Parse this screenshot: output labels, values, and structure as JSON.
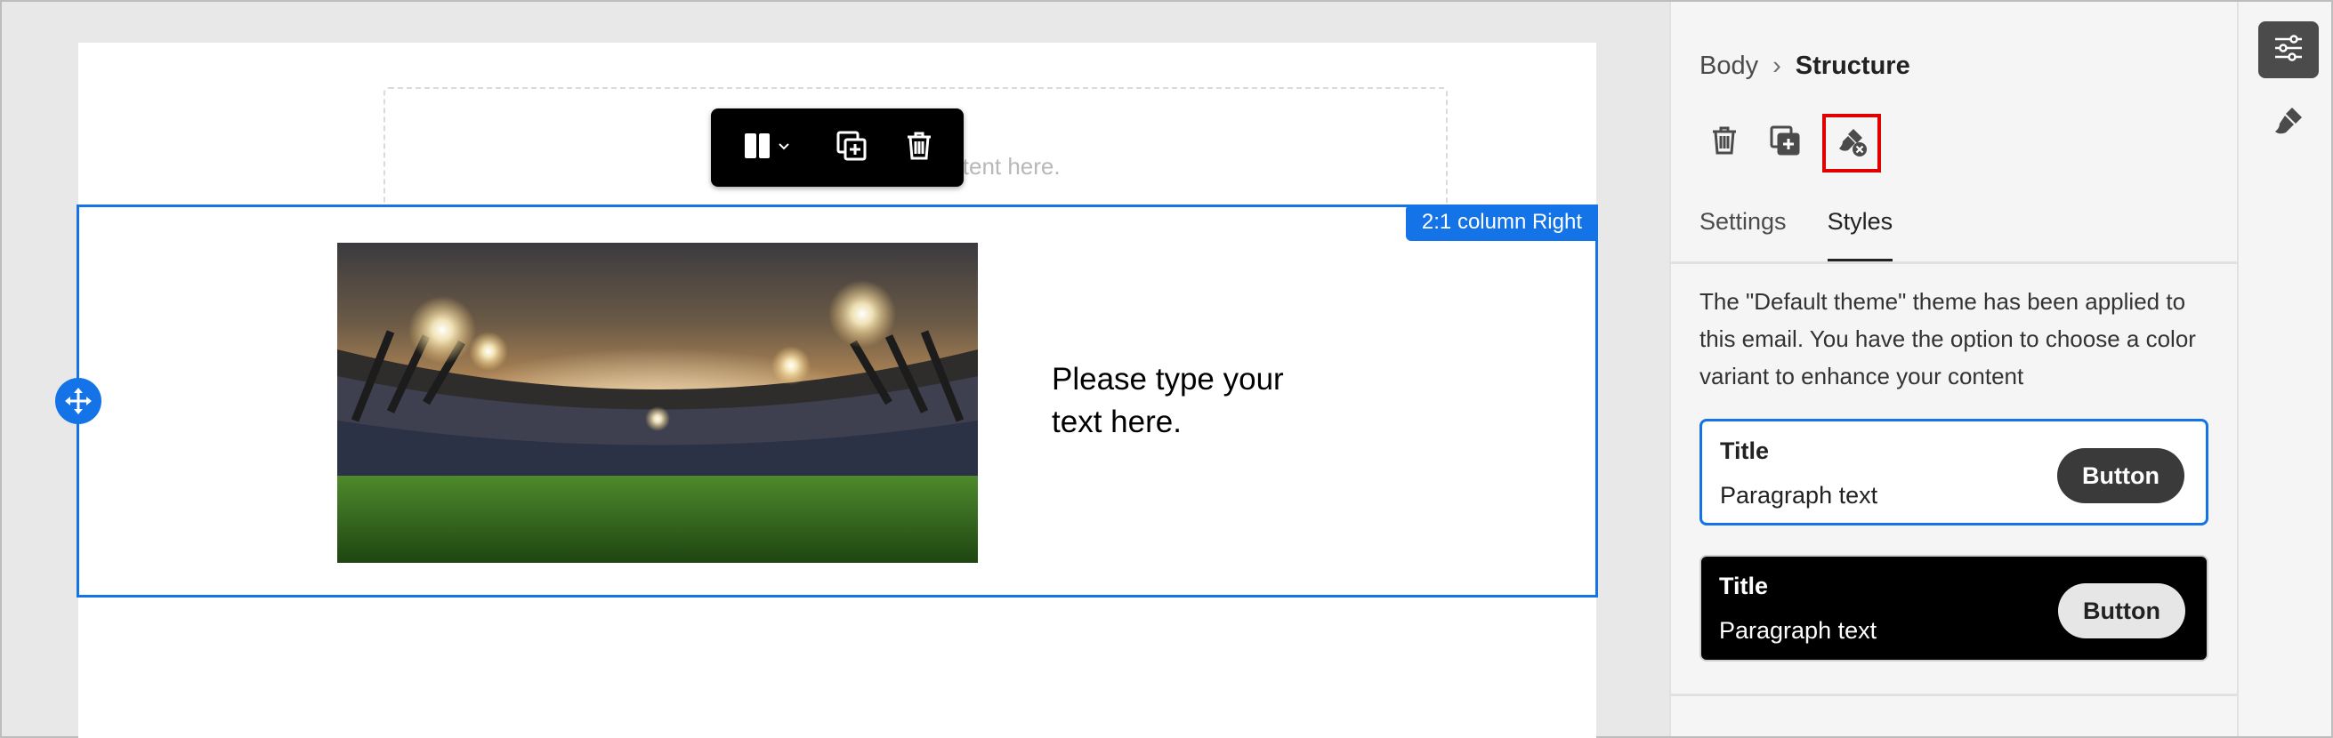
{
  "canvas": {
    "dropzone_text": "Drag and drop content here.",
    "section_badge": "2:1 column Right",
    "hero_text_line1": "Please type your",
    "hero_text_line2": "text here.",
    "image_alt": "stadium-photo",
    "floating_toolbar": {
      "icons": [
        "columns-icon",
        "chevron-down-icon",
        "duplicate-icon",
        "trash-icon"
      ]
    }
  },
  "panel": {
    "breadcrumb": {
      "parent": "Body",
      "separator": "›",
      "current": "Structure"
    },
    "tools": [
      "trash-icon",
      "duplicate-icon",
      "reset-style-icon"
    ],
    "tabs": [
      {
        "label": "Settings",
        "active": false
      },
      {
        "label": "Styles",
        "active": true
      }
    ],
    "theme_description": "The \"Default theme\" theme has been applied to this email. You have the option to choose a color variant to enhance your content",
    "theme_variants": [
      {
        "title": "Title",
        "paragraph": "Paragraph text",
        "button": "Button",
        "selected": true,
        "variant": "light"
      },
      {
        "title": "Title",
        "paragraph": "Paragraph text",
        "button": "Button",
        "selected": false,
        "variant": "dark"
      }
    ]
  },
  "rail": {
    "items": [
      {
        "icon": "sliders-icon",
        "active": true
      },
      {
        "icon": "brush-icon",
        "active": false
      }
    ]
  },
  "colors": {
    "accent": "#1473e6",
    "highlight": "#e00000"
  }
}
